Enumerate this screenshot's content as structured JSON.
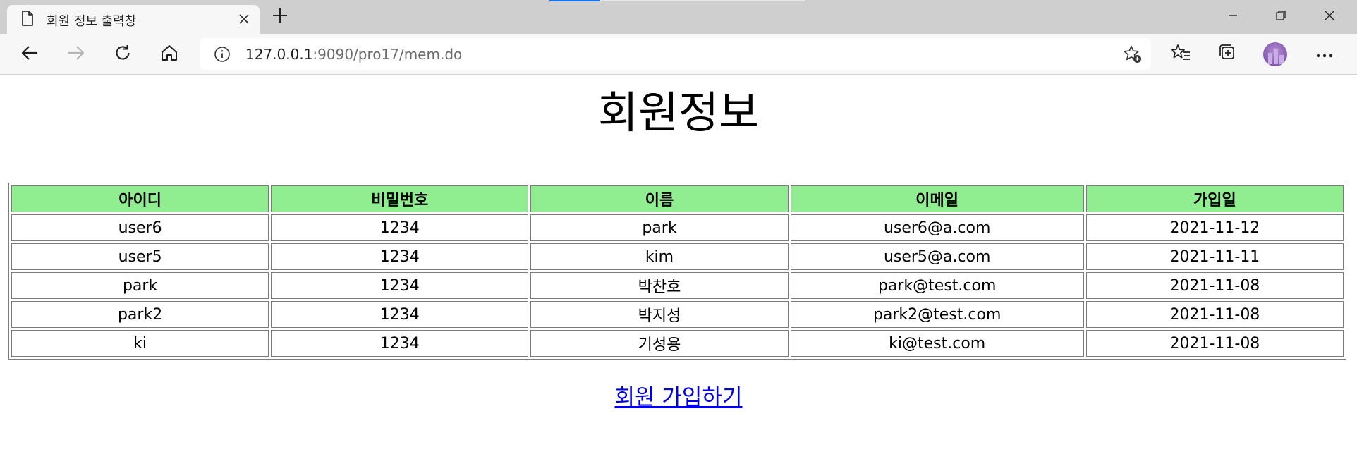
{
  "browser": {
    "tab_title": "회원 정보 출력창",
    "url_host": "127.0.0.1",
    "url_rest": ":9090/pro17/mem.do",
    "accent_color": "#1a73e8"
  },
  "icons": {
    "page": "page-icon",
    "close": "close-icon",
    "new_tab": "plus-icon",
    "minimize": "minimize-icon",
    "restore": "restore-icon",
    "window_close": "window-close-icon",
    "back": "back-arrow-icon",
    "forward": "forward-arrow-icon",
    "refresh": "refresh-icon",
    "home": "home-icon",
    "info": "info-icon",
    "add_favorite": "star-plus-icon",
    "favorites": "favorites-icon",
    "collections": "collections-icon",
    "profile": "avatar",
    "menu": "more-icon"
  },
  "page": {
    "title": "회원정보",
    "header_color": "#90ee90",
    "columns": [
      "아이디",
      "비밀번호",
      "이름",
      "이메일",
      "가입일"
    ],
    "rows": [
      [
        "user6",
        "1234",
        "park",
        "user6@a.com",
        "2021-11-12"
      ],
      [
        "user5",
        "1234",
        "kim",
        "user5@a.com",
        "2021-11-11"
      ],
      [
        "park",
        "1234",
        "박찬호",
        "park@test.com",
        "2021-11-08"
      ],
      [
        "park2",
        "1234",
        "박지성",
        "park2@test.com",
        "2021-11-08"
      ],
      [
        "ki",
        "1234",
        "기성용",
        "ki@test.com",
        "2021-11-08"
      ]
    ],
    "signup_link": "회원 가입하기"
  }
}
